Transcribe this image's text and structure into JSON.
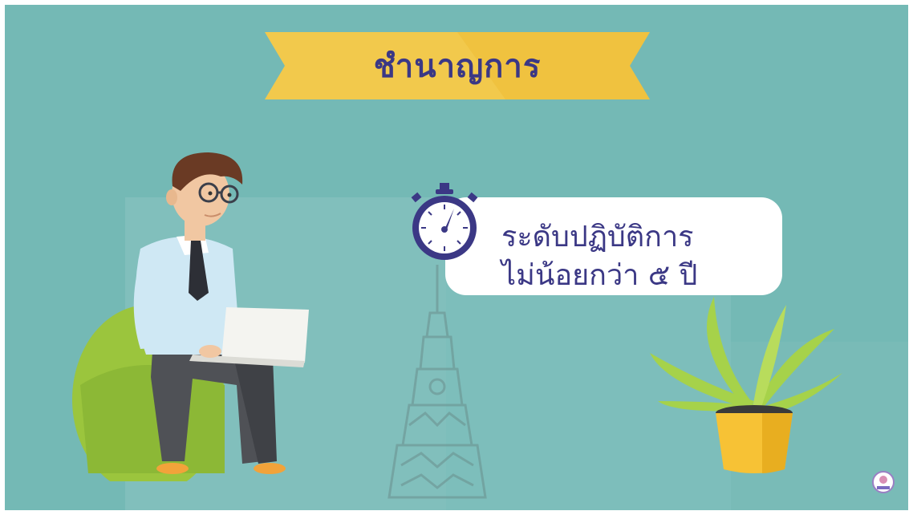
{
  "banner": {
    "title": "ชำนาญการ"
  },
  "bubble": {
    "line1": "ระดับปฏิบัติการ",
    "line2": "ไม่น้อยกว่า ๕ ปี"
  },
  "colors": {
    "background": "#74b9b5",
    "banner": "#f2c94c",
    "text": "#3b3885",
    "shirt": "#cfe8f4",
    "beanbag": "#9bc53d",
    "pot": "#f7c235",
    "leaves": "#a6d24a"
  },
  "icons": [
    "stopwatch-icon",
    "tower-silhouette",
    "potted-plant",
    "org-logo-icon"
  ]
}
